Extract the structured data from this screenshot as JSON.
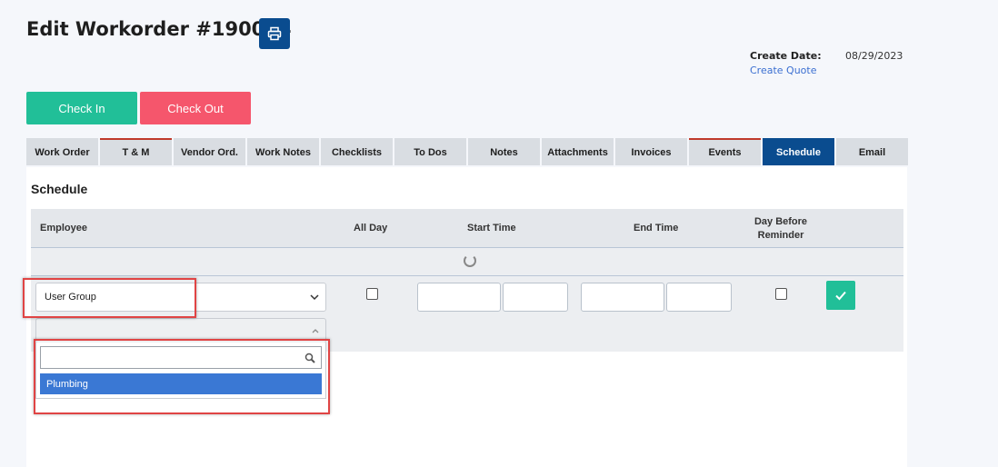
{
  "page": {
    "title": "Edit Workorder #190064",
    "create_date_label": "Create Date:",
    "create_date_value": "08/29/2023",
    "create_quote_link": "Create Quote"
  },
  "actions": {
    "check_in": "Check In",
    "check_out": "Check Out"
  },
  "tabs": [
    {
      "label": "Work Order"
    },
    {
      "label": "T & M"
    },
    {
      "label": "Vendor Ord."
    },
    {
      "label": "Work Notes"
    },
    {
      "label": "Checklists"
    },
    {
      "label": "To Dos"
    },
    {
      "label": "Notes"
    },
    {
      "label": "Attachments"
    },
    {
      "label": "Invoices"
    },
    {
      "label": "Events"
    },
    {
      "label": "Schedule"
    },
    {
      "label": "Email"
    }
  ],
  "active_tab": "Schedule",
  "schedule": {
    "title": "Schedule",
    "columns": {
      "employee": "Employee",
      "all_day": "All Day",
      "start_time": "Start Time",
      "end_time": "End Time",
      "reminder_line1": "Day Before",
      "reminder_line2": "Reminder"
    },
    "employee_select_value": "User Group",
    "dropdown": {
      "search_value": "",
      "options": [
        "Plumbing"
      ]
    }
  },
  "colors": {
    "primary": "#0a4c8f",
    "check_in": "#21bf98",
    "check_out": "#f5566c",
    "selected_option": "#3a78d4",
    "highlight": "#e04444"
  },
  "icons": {
    "print": "print-icon",
    "save": "check-icon",
    "chevron": "chevron-down-icon",
    "search": "search-icon",
    "loading": "spinner-icon"
  }
}
